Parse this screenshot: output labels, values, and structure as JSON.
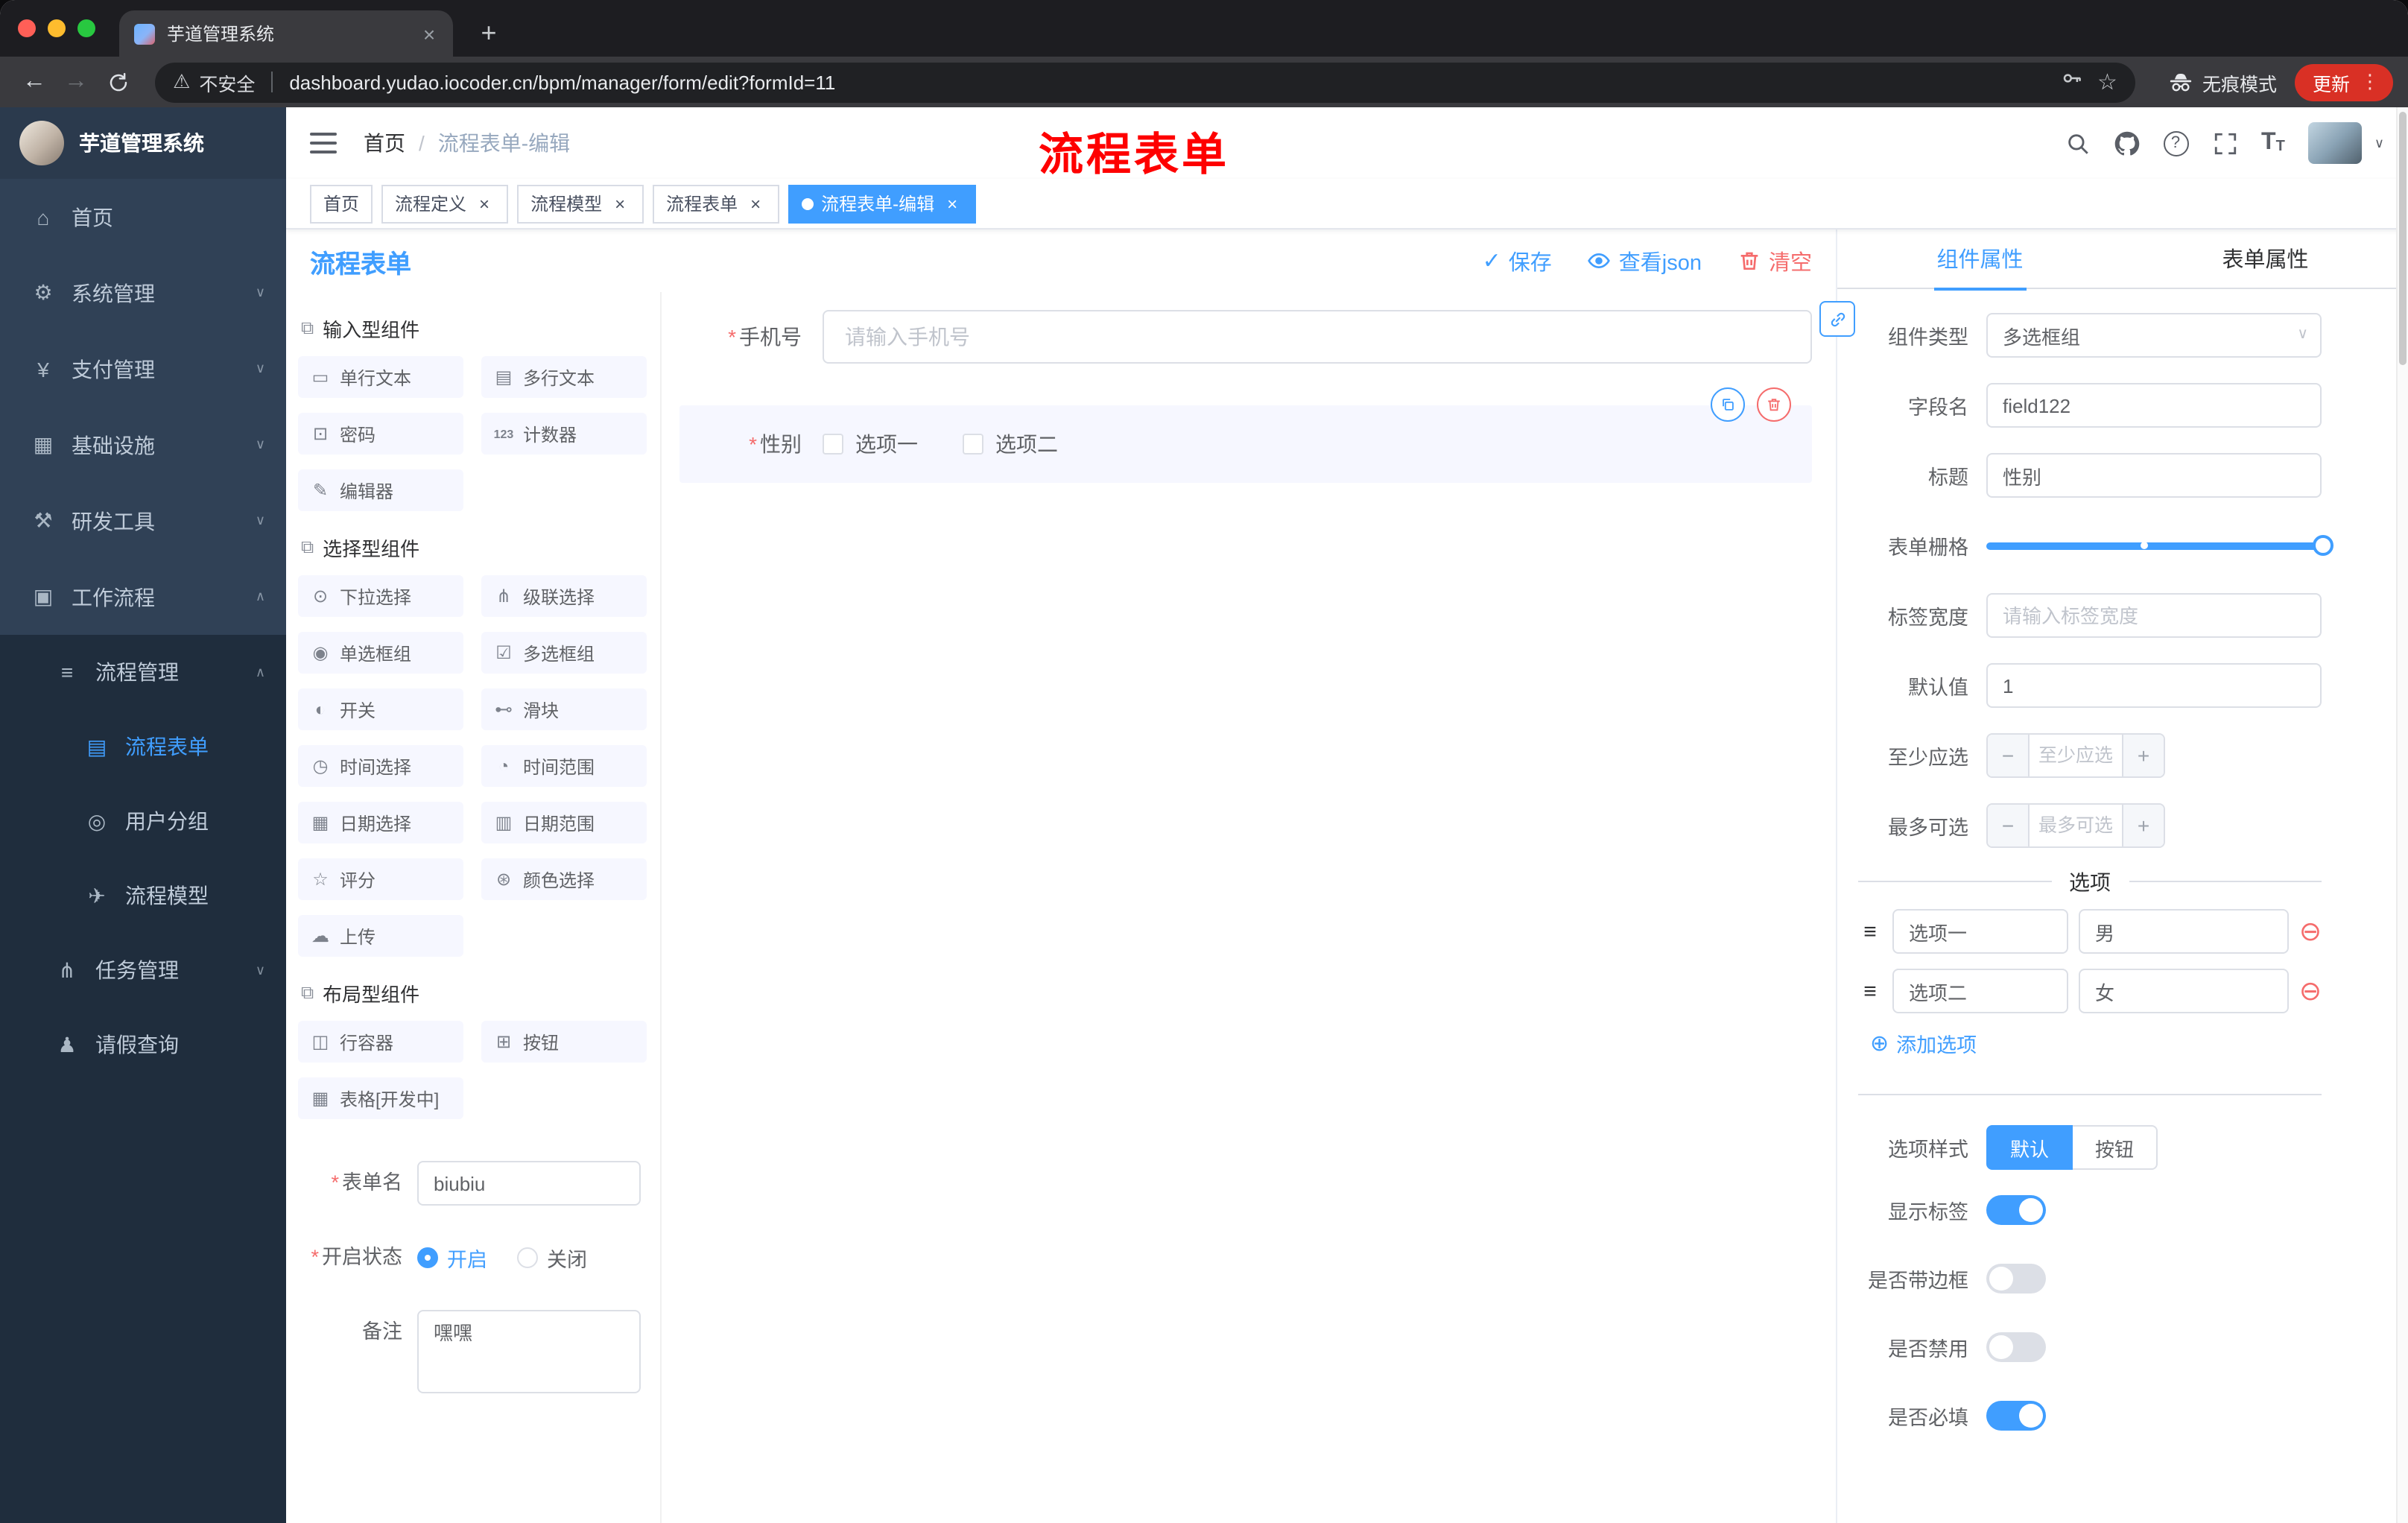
{
  "icons": {
    "back": "←",
    "forward": "→",
    "star": "☆",
    "dots": "⋮",
    "plus": "+",
    "close": "×",
    "warning": "⚠",
    "check": "✓",
    "down": "∨",
    "up": "∧",
    "sep": "/",
    "minus": "−",
    "plus_small": "+",
    "add": "⊕",
    "remove": "⊖",
    "drag": "≡",
    "question": "?",
    "req": "*",
    "font_large": "T",
    "font_small": "T"
  },
  "chrome": {
    "tab_title": "芋道管理系统",
    "security_label": "不安全",
    "url": "dashboard.yudao.iocoder.cn/bpm/manager/form/edit?formId=11",
    "incognito_label": "无痕模式",
    "update_label": "更新"
  },
  "sidebar": {
    "app_title": "芋道管理系统",
    "items": [
      {
        "icon": "⌂",
        "label": "首页"
      },
      {
        "icon": "⚙",
        "label": "系统管理",
        "arrow": "∨"
      },
      {
        "icon": "¥",
        "label": "支付管理",
        "arrow": "∨"
      },
      {
        "icon": "▦",
        "label": "基础设施",
        "arrow": "∨"
      },
      {
        "icon": "⚒",
        "label": "研发工具",
        "arrow": "∨"
      },
      {
        "icon": "▣",
        "label": "工作流程",
        "arrow": "∧"
      }
    ],
    "sub": [
      {
        "icon": "≡",
        "label": "流程管理",
        "arrow": "∧"
      },
      {
        "icon": "▤",
        "label": "流程表单"
      },
      {
        "icon": "◎",
        "label": "用户分组"
      },
      {
        "icon": "✈",
        "label": "流程模型"
      },
      {
        "icon": "⋔",
        "label": "任务管理",
        "arrow": "∨"
      },
      {
        "icon": "♟",
        "label": "请假查询"
      }
    ]
  },
  "header": {
    "breadcrumb_home": "首页",
    "breadcrumb_current": "流程表单-编辑",
    "annotation": "流程表单"
  },
  "tags": [
    {
      "label": "首页"
    },
    {
      "label": "流程定义"
    },
    {
      "label": "流程模型"
    },
    {
      "label": "流程表单"
    },
    {
      "label": "流程表单-编辑"
    }
  ],
  "designer": {
    "title": "流程表单",
    "save_label": "保存",
    "view_json_label": "查看json",
    "clear_label": "清空",
    "groups": [
      {
        "title": "输入型组件",
        "items": [
          {
            "icon": "▭",
            "label": "单行文本"
          },
          {
            "icon": "▤",
            "label": "多行文本"
          },
          {
            "icon": "⊡",
            "label": "密码"
          },
          {
            "icon": "123",
            "label": "计数器"
          },
          {
            "icon": "✎",
            "label": "编辑器"
          }
        ]
      },
      {
        "title": "选择型组件",
        "items": [
          {
            "icon": "⊙",
            "label": "下拉选择"
          },
          {
            "icon": "⋔",
            "label": "级联选择"
          },
          {
            "icon": "◉",
            "label": "单选框组"
          },
          {
            "icon": "☑",
            "label": "多选框组"
          },
          {
            "icon": "◐",
            "label": "开关"
          },
          {
            "icon": "⊷",
            "label": "滑块"
          },
          {
            "icon": "◷",
            "label": "时间选择"
          },
          {
            "icon": "◔",
            "label": "时间范围"
          },
          {
            "icon": "▦",
            "label": "日期选择"
          },
          {
            "icon": "▥",
            "label": "日期范围"
          },
          {
            "icon": "☆",
            "label": "评分"
          },
          {
            "icon": "⊛",
            "label": "颜色选择"
          },
          {
            "icon": "☁",
            "label": "上传"
          }
        ]
      },
      {
        "title": "布局型组件",
        "items": [
          {
            "icon": "◫",
            "label": "行容器"
          },
          {
            "icon": "⊞",
            "label": "按钮"
          },
          {
            "icon": "▦",
            "label": "表格[开发中]"
          }
        ]
      }
    ],
    "meta": {
      "name_label": "表单名",
      "name_value": "biubiu",
      "status_label": "开启状态",
      "status_on": "开启",
      "status_off": "关闭",
      "remark_label": "备注",
      "remark_value": "嘿嘿"
    },
    "canvas": {
      "phone_label": "手机号",
      "phone_placeholder": "请输入手机号",
      "gender_label": "性别",
      "gender_option1": "选项一",
      "gender_option2": "选项二"
    }
  },
  "props": {
    "tab_component": "组件属性",
    "tab_form": "表单属性",
    "rows": {
      "type_label": "组件类型",
      "type_value": "多选框组",
      "field_label": "字段名",
      "field_value": "field122",
      "title_label": "标题",
      "title_value": "性别",
      "grid_label": "表单栅格",
      "width_label": "标签宽度",
      "width_placeholder": "请输入标签宽度",
      "default_label": "默认值",
      "default_value": "1",
      "min_label": "至少应选",
      "min_placeholder": "至少应选",
      "max_label": "最多可选",
      "max_placeholder": "最多可选"
    },
    "options_title": "选项",
    "options": [
      {
        "label": "选项一",
        "value": "男"
      },
      {
        "label": "选项二",
        "value": "女"
      }
    ],
    "add_option": "添加选项",
    "style_label": "选项样式",
    "style_default": "默认",
    "style_button": "按钮",
    "switches": [
      {
        "label": "显示标签",
        "on": true
      },
      {
        "label": "是否带边框",
        "on": false
      },
      {
        "label": "是否禁用",
        "on": false
      },
      {
        "label": "是否必填",
        "on": true
      }
    ]
  }
}
